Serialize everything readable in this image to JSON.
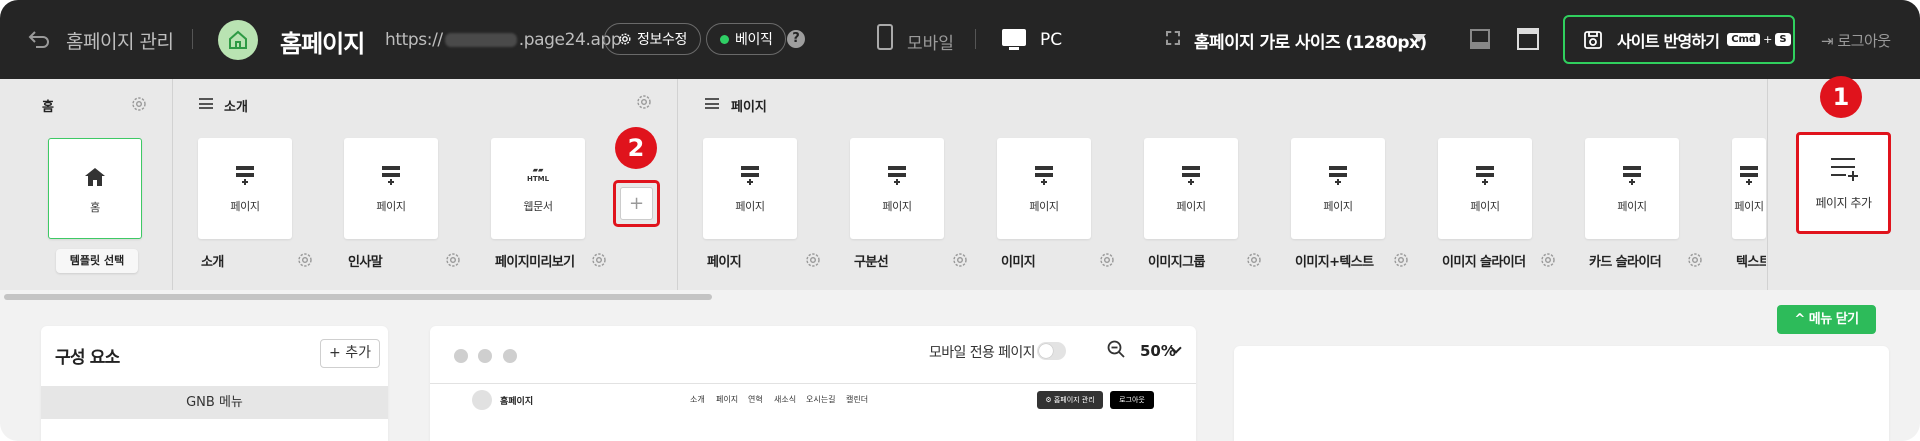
{
  "topbar": {
    "manage_label": "홈페이지 관리",
    "site_title": "홈페이지",
    "url_prefix": "https://",
    "url_suffix": ".page24.app",
    "edit_info_label": "정보수정",
    "beta_label": "베이직",
    "help_label": "?",
    "mobile_label": "모바일",
    "pc_label": "PC",
    "size_label": "홈페이지 가로 사이즈 (1280px)",
    "apply_label": "사이트 반영하기",
    "apply_key1": "Cmd",
    "apply_plus": "+",
    "apply_key2": "S",
    "logout_label": "로그아웃"
  },
  "strip": {
    "sections": {
      "home": "홈",
      "intro": "소개",
      "page": "페이지"
    },
    "home_card": {
      "icon_label": "홈",
      "template_button": "템플릿 선택"
    },
    "intro_cards": [
      {
        "card_label": "페이지",
        "name": "소개"
      },
      {
        "card_label": "페이지",
        "name": "인사말"
      },
      {
        "card_label": "웹문서",
        "name": "페이지미리보기",
        "icon_text": "HTML"
      }
    ],
    "add_inline": "+",
    "page_cards": [
      {
        "card_label": "페이지",
        "name": "페이지"
      },
      {
        "card_label": "페이지",
        "name": "구분선"
      },
      {
        "card_label": "페이지",
        "name": "이미지"
      },
      {
        "card_label": "페이지",
        "name": "이미지그룹"
      },
      {
        "card_label": "페이지",
        "name": "이미지+텍스트"
      },
      {
        "card_label": "페이지",
        "name": "이미지 슬라이더"
      },
      {
        "card_label": "페이지",
        "name": "카드 슬라이더"
      },
      {
        "card_label": "페이지",
        "name": "텍스트"
      }
    ],
    "add_page_label": "페이지 추가",
    "badge1": "1",
    "badge2": "2"
  },
  "bottom": {
    "close_menu_label": "^ 메뉴 닫기",
    "components_title": "구성 요소",
    "components_add": "+ 추가",
    "gnb_label": "GNB 메뉴",
    "mobile_only_label": "모바일 전용 페이지",
    "zoom_value": "50%",
    "preview": {
      "site_title": "홈페이지",
      "nav": [
        "소개",
        "페이지",
        "연혁",
        "새소식",
        "오시는길",
        "캘린더"
      ],
      "manage_btn": "⚙ 홈페이지 관리",
      "logout_btn": "로그아웃"
    }
  },
  "colors": {
    "topbar_bg": "#252525",
    "accent_green": "#2dbb5a",
    "highlight_red": "#e0131c",
    "strip_bg": "#e9e9e9"
  }
}
